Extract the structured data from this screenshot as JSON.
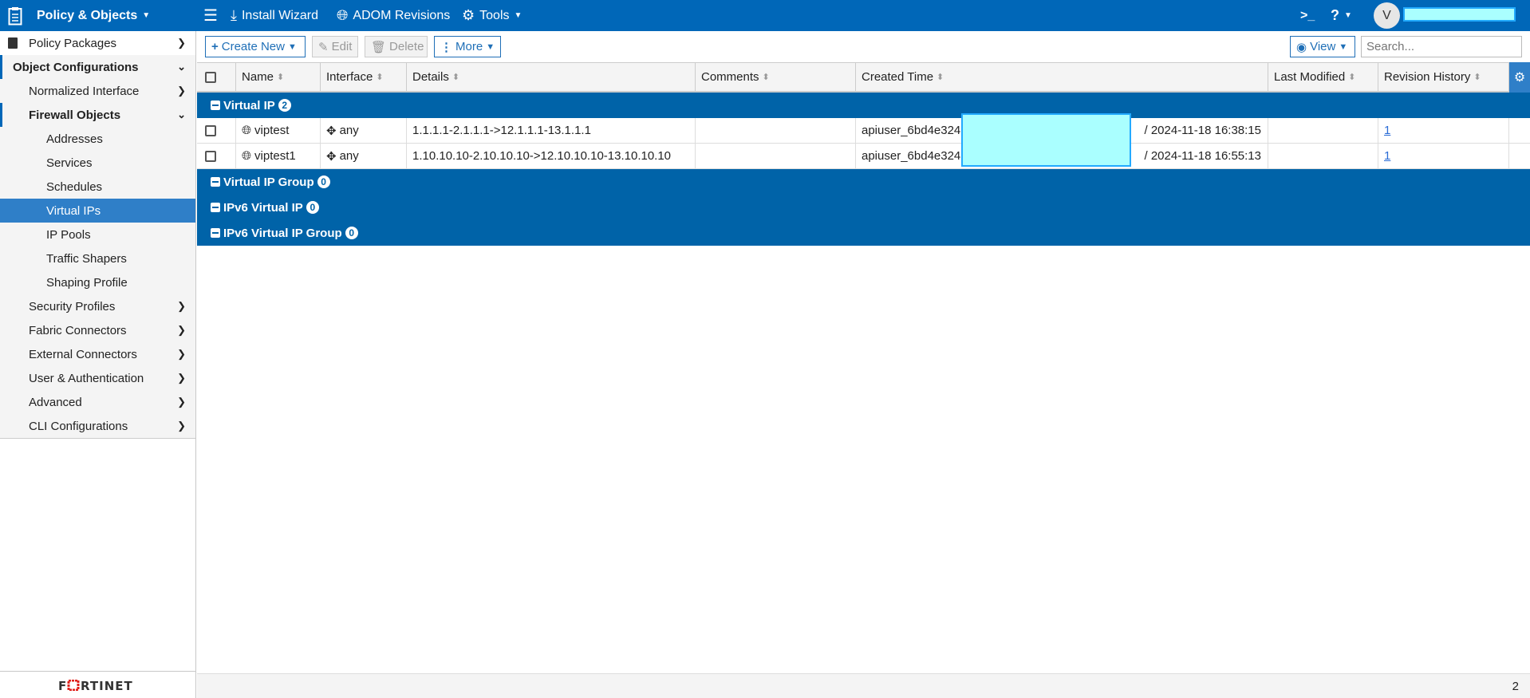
{
  "topbar": {
    "module": "Policy & Objects",
    "install_wizard": "Install Wizard",
    "adom_revisions": "ADOM Revisions",
    "tools": "Tools",
    "avatar_initial": "V"
  },
  "sidebar": {
    "items": [
      {
        "label": "Policy Packages"
      },
      {
        "label": "Object Configurations"
      },
      {
        "label": "Normalized Interface"
      },
      {
        "label": "Firewall Objects"
      },
      {
        "label": "Addresses"
      },
      {
        "label": "Services"
      },
      {
        "label": "Schedules"
      },
      {
        "label": "Virtual IPs"
      },
      {
        "label": "IP Pools"
      },
      {
        "label": "Traffic Shapers"
      },
      {
        "label": "Shaping Profile"
      },
      {
        "label": "Security Profiles"
      },
      {
        "label": "Fabric Connectors"
      },
      {
        "label": "External Connectors"
      },
      {
        "label": "User & Authentication"
      },
      {
        "label": "Advanced"
      },
      {
        "label": "CLI Configurations"
      }
    ],
    "logo": "FORTINET"
  },
  "toolbar": {
    "create_new": "Create New",
    "edit": "Edit",
    "delete": "Delete",
    "more": "More",
    "view": "View",
    "search_placeholder": "Search..."
  },
  "table": {
    "columns": [
      "Name",
      "Interface",
      "Details",
      "Comments",
      "Created Time",
      "Last Modified",
      "Revision History"
    ],
    "groups": [
      {
        "label": "Virtual IP",
        "count": "2"
      },
      {
        "label": "Virtual IP Group",
        "count": "0"
      },
      {
        "label": "IPv6 Virtual IP",
        "count": "0"
      },
      {
        "label": "IPv6 Virtual IP Group",
        "count": "0"
      }
    ],
    "rows": [
      {
        "name": "viptest",
        "interface": "any",
        "details": "1.1.1.1-2.1.1.1->12.1.1.1-13.1.1.1",
        "comments": "",
        "created_prefix": "apiuser_6bd4e324",
        "created_suffix": "/ 2024-11-18 16:38:15",
        "last_modified": "",
        "revision": "1"
      },
      {
        "name": "viptest1",
        "interface": "any",
        "details": "1.10.10.10-2.10.10.10->12.10.10.10-13.10.10.10",
        "comments": "",
        "created_prefix": "apiuser_6bd4e324",
        "created_suffix": "/ 2024-11-18 16:55:13",
        "last_modified": "",
        "revision": "1"
      }
    ]
  },
  "status": {
    "count": "2"
  },
  "colors": {
    "topbar": "#0067b8",
    "group_row": "#0063a8",
    "active_item": "#2f7fc8"
  }
}
